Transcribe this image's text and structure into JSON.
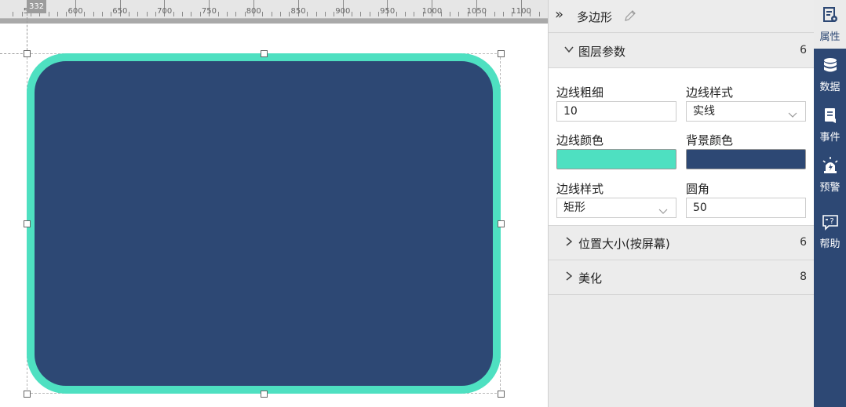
{
  "ruler": {
    "marker": "332",
    "labels": [
      "550",
      "600",
      "650",
      "700",
      "750",
      "800",
      "850",
      "900",
      "950",
      "1000",
      "1050",
      "1100"
    ]
  },
  "shape": {
    "border_color": "#4ee0c1",
    "fill_color": "#2d4874"
  },
  "panel": {
    "title": "多边形",
    "sections": {
      "layer": {
        "title": "图层参数",
        "count": "6"
      },
      "position": {
        "title": "位置大小(按屏幕)",
        "count": "6"
      },
      "beautify": {
        "title": "美化",
        "count": "8"
      }
    },
    "fields": {
      "border_width": {
        "label": "边线粗细",
        "value": "10"
      },
      "border_style": {
        "label": "边线样式",
        "value": "实线"
      },
      "border_color": {
        "label": "边线颜色",
        "color": "#4ee0c1"
      },
      "bg_color": {
        "label": "背景颜色",
        "color": "#2d4874"
      },
      "border_shape": {
        "label": "边线样式",
        "value": "矩形"
      },
      "corner_radius": {
        "label": "圆角",
        "value": "50"
      }
    }
  },
  "sidebar": {
    "items": [
      {
        "label": "属性",
        "icon": "properties-icon"
      },
      {
        "label": "数据",
        "icon": "database-icon"
      },
      {
        "label": "事件",
        "icon": "event-icon"
      },
      {
        "label": "预警",
        "icon": "alarm-icon"
      },
      {
        "label": "帮助",
        "icon": "help-icon"
      }
    ]
  }
}
